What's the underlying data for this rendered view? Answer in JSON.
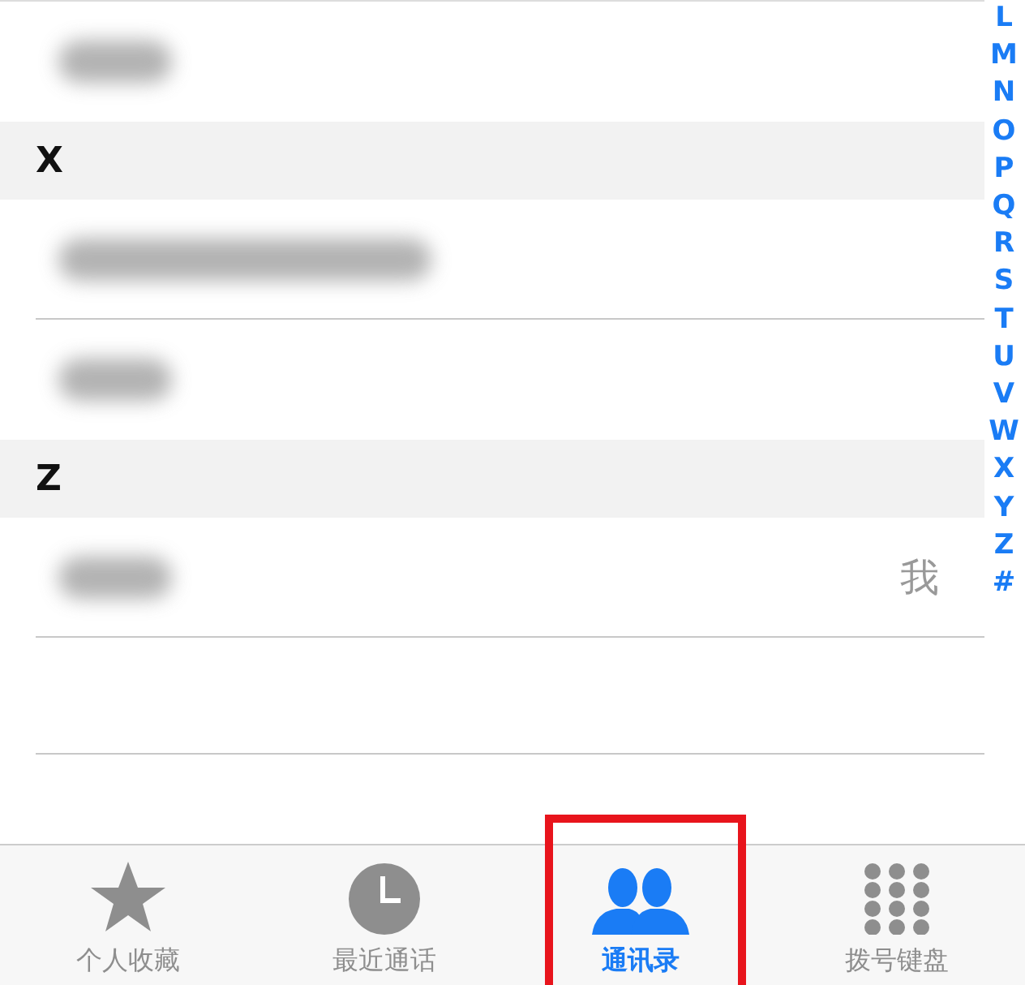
{
  "rows": [
    {
      "kind": "contact",
      "redacted": true
    },
    {
      "kind": "header",
      "label": "X"
    },
    {
      "kind": "contact",
      "redacted": true
    },
    {
      "kind": "contact",
      "redacted": true
    },
    {
      "kind": "header",
      "label": "Z"
    },
    {
      "kind": "contact",
      "redacted": true,
      "detail": "我"
    },
    {
      "kind": "empty"
    }
  ],
  "index": [
    "L",
    "M",
    "N",
    "O",
    "P",
    "Q",
    "R",
    "S",
    "T",
    "U",
    "V",
    "W",
    "X",
    "Y",
    "Z",
    "#"
  ],
  "tabs": [
    {
      "kind": "star",
      "label": "个人收藏",
      "selected": false
    },
    {
      "kind": "clock",
      "label": "最近通话",
      "selected": false
    },
    {
      "kind": "people",
      "label": "通讯录",
      "selected": true,
      "highlighted": true
    },
    {
      "kind": "keypad",
      "label": "拨号键盘",
      "selected": false
    }
  ]
}
